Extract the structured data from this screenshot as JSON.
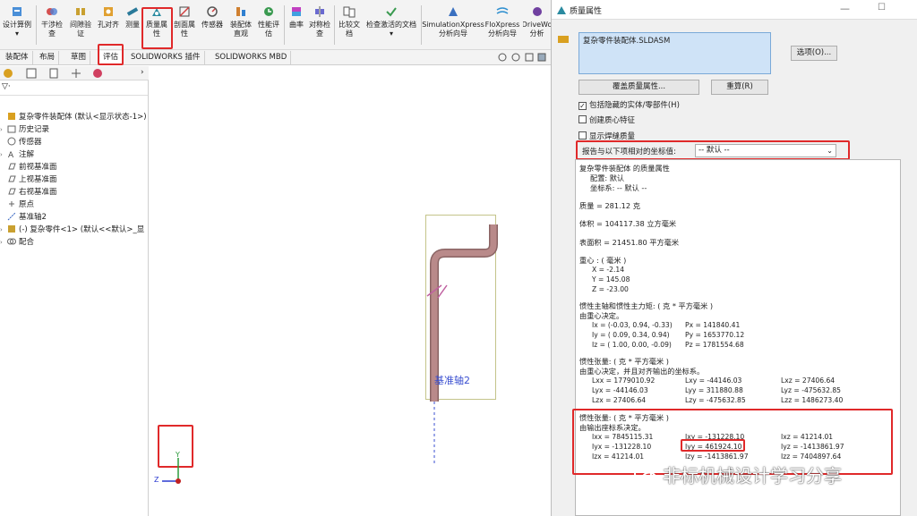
{
  "ribbon": {
    "tools": [
      {
        "label1": "设计算例",
        "label2": "▾"
      },
      {
        "label1": "干涉检",
        "label2": "查"
      },
      {
        "label1": "间隙验",
        "label2": "证"
      },
      {
        "label1": "孔对齐",
        "label2": ""
      },
      {
        "label1": "测量",
        "label2": ""
      },
      {
        "label1": "质量属",
        "label2": "性"
      },
      {
        "label1": "剖面属",
        "label2": "性"
      },
      {
        "label1": "传感器",
        "label2": ""
      },
      {
        "label1": "装配体",
        "label2": "直观"
      },
      {
        "label1": "性能评",
        "label2": "估"
      },
      {
        "label1": "曲率",
        "label2": ""
      },
      {
        "label1": "对称检",
        "label2": "查"
      },
      {
        "label1": "比较文",
        "label2": "档"
      },
      {
        "label1": "检查激活的文档",
        "label2": "▾"
      },
      {
        "label1": "SimulationXpress",
        "label2": "分析向导"
      },
      {
        "label1": "FloXpress",
        "label2": "分析向导"
      },
      {
        "label1": "DriveWo",
        "label2": "分析"
      }
    ]
  },
  "tabs": [
    "装配体",
    "布局",
    "草图",
    "评估",
    "SOLIDWORKS 插件",
    "SOLIDWORKS MBD"
  ],
  "tree": {
    "items": [
      "复杂零件装配体 (默认<显示状态-1>)",
      "历史记录",
      "传感器",
      "注解",
      "前视基准面",
      "上视基准面",
      "右视基准面",
      "原点",
      "基准轴2",
      "(-) 复杂零件<1> (默认<<默认>_显",
      "配合"
    ]
  },
  "graphics": {
    "axis_label": "基准轴2",
    "triad_y": "Y",
    "triad_z": "Z"
  },
  "panel": {
    "title": "质量属性",
    "file": "复杂零件装配体.SLDASM",
    "options_btn": "选项(O)...",
    "override_btn": "覆盖质量属性...",
    "recalc_btn": "重算(R)",
    "chk_hidden": "包括隐藏的实体/零部件(H)",
    "chk_com": "创建质心特征",
    "chk_weld": "显示焊缝质量",
    "coord_label": "报告与以下项相对的坐标值:",
    "coord_value": "-- 默认 --"
  },
  "results": {
    "heading": "复杂零件装配体 的质量属性",
    "config": "配置:  默认",
    "coordsys": "坐标系:  -- 默认 --",
    "mass": "质量 = 281.12 克",
    "volume": "体积 = 104117.38 立方毫米",
    "area": "表面积 = 21451.80  平方毫米",
    "com_title": "重心 : ( 毫米 )",
    "com_x": "X = -2.14",
    "com_y": "Y = 145.08",
    "com_z": "Z = -23.00",
    "pm_title": "惯性主轴和惯性主力矩: ( 克 *  平方毫米 )",
    "pm_sub": "由重心决定。",
    "ix": "Ix = (-0.03,  0.94, -0.33)",
    "iy": "Iy = ( 0.09,  0.34,  0.94)",
    "iz": "Iz = ( 1.00,  0.00, -0.09)",
    "px": "Px = 141840.41",
    "py": "Py = 1653770.12",
    "pz": "Pz = 1781554.68",
    "t1_title": "惯性张量: ( 克 *  平方毫米 )",
    "t1_sub": "由重心决定，并且对齐输出的坐标系。",
    "lxx": "Lxx = 1779010.92",
    "lxy": "Lxy = -44146.03",
    "lxz": "Lxz = 27406.64",
    "lyx": "Lyx = -44146.03",
    "lyy": "Lyy = 311880.88",
    "lyz": "Lyz = -475632.85",
    "lzx": "Lzx = 27406.64",
    "lzy": "Lzy = -475632.85",
    "lzz": "Lzz = 1486273.40",
    "t2_title": "惯性张量: ( 克 *  平方毫米 )",
    "t2_sub": "由输出座标系决定。",
    "ixx": "Ixx = 7845115.31",
    "ixy": "Ixy = -131228.10",
    "ixz": "Ixz = 41214.01",
    "iyx": "Iyx = -131228.10",
    "iyy": "Iyy = 461924.10",
    "iyz": "Iyz = -1413861.97",
    "izx": "Izx = 41214.01",
    "izy": "Izy = -1413861.97",
    "izz": "Izz = 7404897.64"
  },
  "watermark": "非标机械设计学习分享",
  "colors": {
    "highlight": "#e0292a",
    "accent": "#1f5fbf",
    "pipe": "#b98a8a",
    "file_box": "#cfe3f7"
  }
}
